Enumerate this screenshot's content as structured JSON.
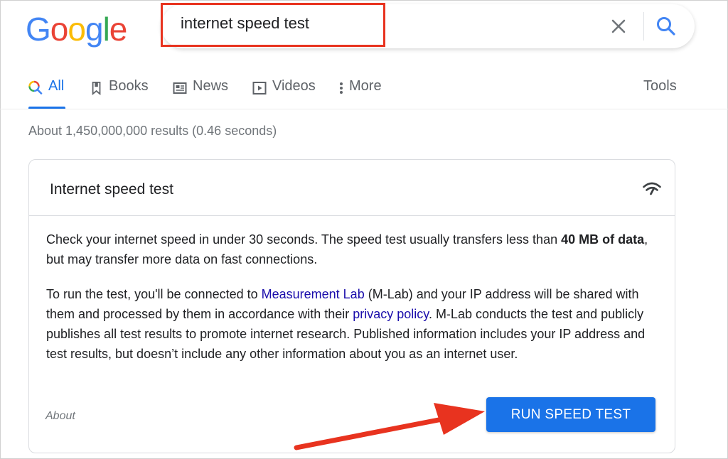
{
  "logo": {
    "text": "Google",
    "letters": [
      {
        "char": "G",
        "color": "#4285F4"
      },
      {
        "char": "o",
        "color": "#EA4335"
      },
      {
        "char": "o",
        "color": "#FBBC05"
      },
      {
        "char": "g",
        "color": "#4285F4"
      },
      {
        "char": "l",
        "color": "#34A853"
      },
      {
        "char": "e",
        "color": "#EA4335"
      }
    ]
  },
  "search": {
    "value": "internet speed test",
    "clear_icon": "close-icon",
    "search_icon": "magnifier-icon"
  },
  "tabs": [
    {
      "label": "All",
      "icon": "search-multicolor-icon",
      "active": true
    },
    {
      "label": "Books",
      "icon": "bookmark-icon",
      "active": false
    },
    {
      "label": "News",
      "icon": "newspaper-icon",
      "active": false
    },
    {
      "label": "Videos",
      "icon": "play-icon",
      "active": false
    },
    {
      "label": "More",
      "icon": "vertical-dots-icon",
      "active": false
    }
  ],
  "tools_label": "Tools",
  "results_count": "About 1,450,000,000 results (0.46 seconds)",
  "card": {
    "title": "Internet speed test",
    "icon": "speed-wifi-icon",
    "p1_a": "Check your internet speed in under 30 seconds. The speed test usually transfers less than ",
    "p1_bold": "40 MB of data",
    "p1_b": ", but may transfer more data on fast connections.",
    "p2_a": "To run the test, you'll be connected to ",
    "p2_link1": "Measurement Lab",
    "p2_b": " (M-Lab) and your IP address will be shared with them and processed by them in accordance with their ",
    "p2_link2": "privacy policy",
    "p2_c": ". M-Lab conducts the test and publicly publishes all test results to promote internet research. Published information includes your IP address and test results, but doesn’t include any other information about you as an internet user.",
    "about_label": "About",
    "button_label": "RUN SPEED TEST"
  },
  "colors": {
    "accent": "#1a73e8",
    "link": "#1a0dab",
    "annotation_red": "#e8331f"
  }
}
